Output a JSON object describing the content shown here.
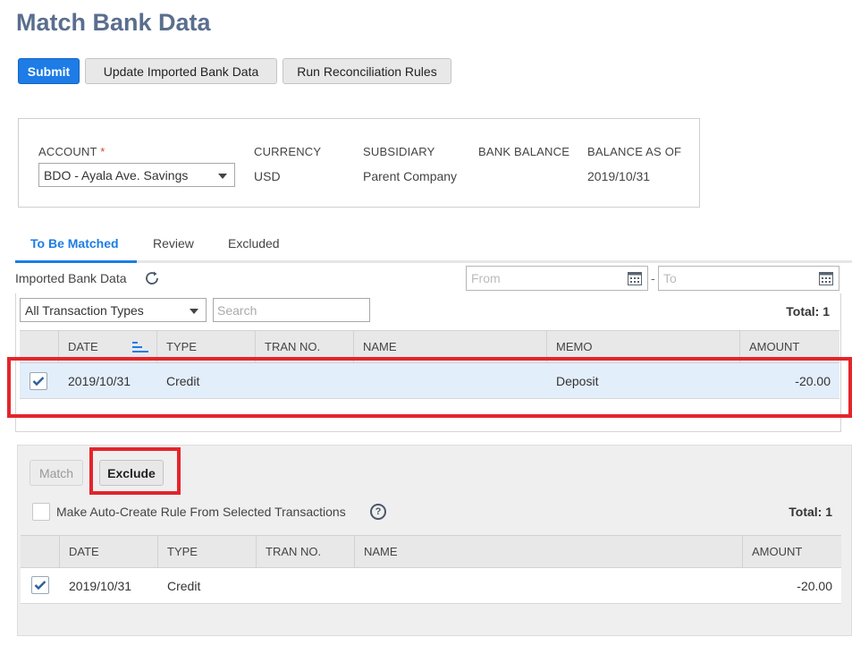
{
  "page": {
    "title": "Match Bank Data"
  },
  "toolbar": {
    "submit_label": "Submit",
    "update_label": "Update Imported Bank Data",
    "run_rules_label": "Run Reconciliation Rules"
  },
  "account": {
    "account_label": "ACCOUNT",
    "required_mark": "*",
    "account_value": "BDO - Ayala Ave. Savings",
    "currency_label": "CURRENCY",
    "currency_value": "USD",
    "subsidiary_label": "SUBSIDIARY",
    "subsidiary_value": "Parent Company",
    "bank_balance_label": "BANK BALANCE",
    "bank_balance_value": "",
    "balance_as_of_label": "BALANCE AS OF",
    "balance_as_of_value": "2019/10/31"
  },
  "tabs": [
    {
      "label": "To Be Matched",
      "active": true
    },
    {
      "label": "Review",
      "active": false
    },
    {
      "label": "Excluded",
      "active": false
    }
  ],
  "imported": {
    "label": "Imported Bank Data",
    "from_placeholder": "From",
    "date_separator": "-",
    "to_placeholder": "To",
    "type_filter": "All Transaction Types",
    "search_placeholder": "Search",
    "total": "Total: 1",
    "columns": [
      "DATE",
      "TYPE",
      "TRAN NO.",
      "NAME",
      "MEMO",
      "AMOUNT"
    ],
    "rows": [
      {
        "checked": true,
        "date": "2019/10/31",
        "type": "Credit",
        "tran_no": "",
        "name": "",
        "memo": "Deposit",
        "amount": "-20.00"
      }
    ]
  },
  "matching": {
    "match_label": "Match",
    "exclude_label": "Exclude",
    "auto_rule_label": "Make Auto-Create Rule From Selected Transactions",
    "help_glyph": "?",
    "total": "Total: 1",
    "columns": [
      "DATE",
      "TYPE",
      "TRAN NO.",
      "NAME",
      "AMOUNT"
    ],
    "rows": [
      {
        "checked": true,
        "date": "2019/10/31",
        "type": "Credit",
        "tran_no": "",
        "name": "",
        "amount": "-20.00"
      }
    ]
  },
  "colors": {
    "accent": "#1d7ce6",
    "title": "#5a6e8e",
    "highlight_row": "#e3eefb",
    "annotation_red": "#e3252b"
  },
  "icons": [
    "calendar-icon",
    "refresh-icon",
    "sort-icon",
    "checkmark-icon",
    "help-icon",
    "chevron-down-icon"
  ]
}
